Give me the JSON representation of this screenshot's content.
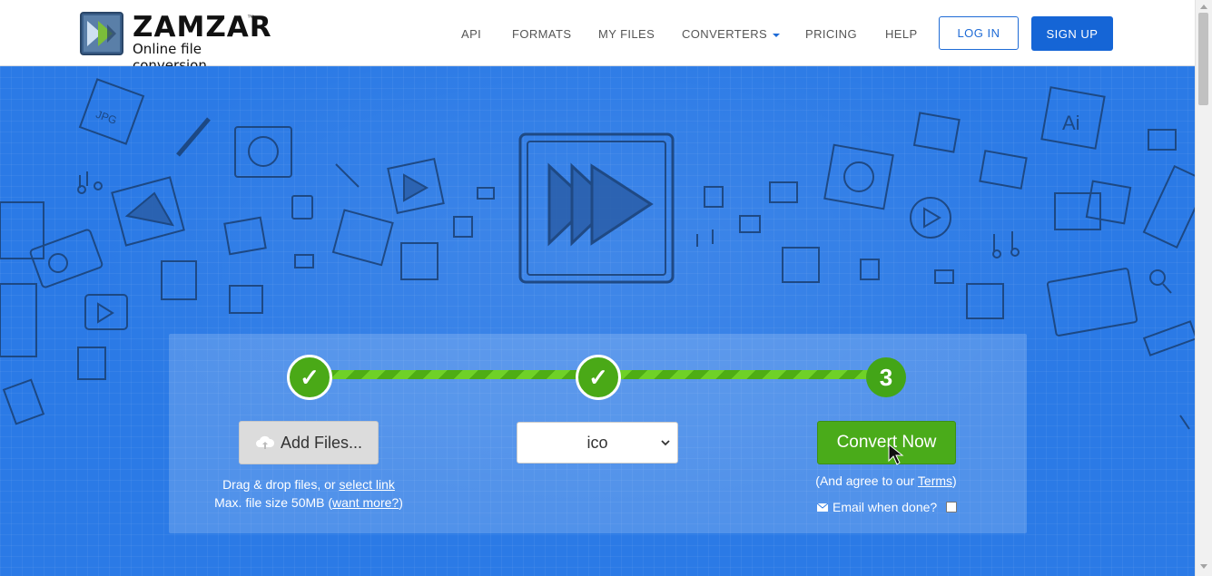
{
  "brand": {
    "name": "ZAMZAR",
    "tm": "™",
    "tagline": "Online file conversion"
  },
  "nav": {
    "api": "API",
    "formats": "FORMATS",
    "my_files": "MY FILES",
    "converters": "CONVERTERS",
    "pricing": "PRICING",
    "help": "HELP",
    "login": "LOG IN",
    "signup": "SIGN UP"
  },
  "converter": {
    "steps": [
      "✓",
      "✓",
      "3"
    ],
    "add_files_label": "Add Files...",
    "drop_text_prefix": "Drag & drop files, or ",
    "select_link": "select link",
    "max_size_prefix": "Max. file size 50MB (",
    "want_more": "want more?",
    "max_size_suffix": ")",
    "format_value": "ico",
    "convert_label": "Convert Now",
    "agree_prefix": "(And agree to our ",
    "terms_link": "Terms",
    "agree_suffix": ")",
    "email_label": "Email when done?"
  },
  "colors": {
    "accent_blue": "#1565d6",
    "hero_blue": "#2b7ae6",
    "green": "#4aab1a"
  }
}
